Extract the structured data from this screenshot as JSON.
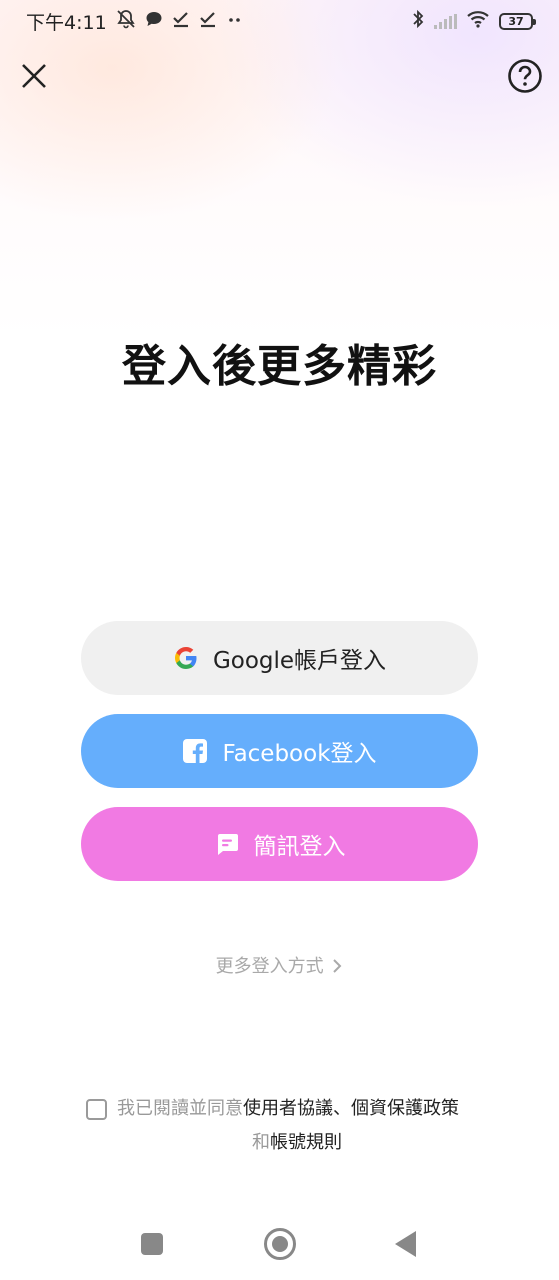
{
  "status_bar": {
    "time": "下午4:11",
    "battery": "37",
    "icons": [
      "notifications-off-icon",
      "chat-bubble-icon",
      "check-icon",
      "check-icon",
      "more-dots-icon",
      "bluetooth-icon",
      "signal-icon",
      "wifi-icon",
      "battery-icon"
    ]
  },
  "header": {
    "close_icon": "close-icon",
    "help_icon": "help-icon"
  },
  "headline": "登入後更多精彩",
  "buttons": {
    "google": {
      "label": "Google帳戶登入",
      "icon": "google-icon",
      "color": "#f0f0f0"
    },
    "facebook": {
      "label": "Facebook登入",
      "icon": "facebook-icon",
      "color": "#65aefc"
    },
    "sms": {
      "label": "簡訊登入",
      "icon": "message-icon",
      "color": "#f17ae3"
    }
  },
  "more_login": {
    "label": "更多登入方式",
    "icon": "chevron-right-icon"
  },
  "agreement": {
    "prefix": "我已閱讀並同意",
    "user_agreement": "使用者協議",
    "separator": "、",
    "privacy_policy": "個資保護政策",
    "and": "和",
    "account_rules": "帳號規則"
  },
  "nav_bar": {
    "icons": [
      "recents-icon",
      "home-icon",
      "back-icon"
    ]
  }
}
